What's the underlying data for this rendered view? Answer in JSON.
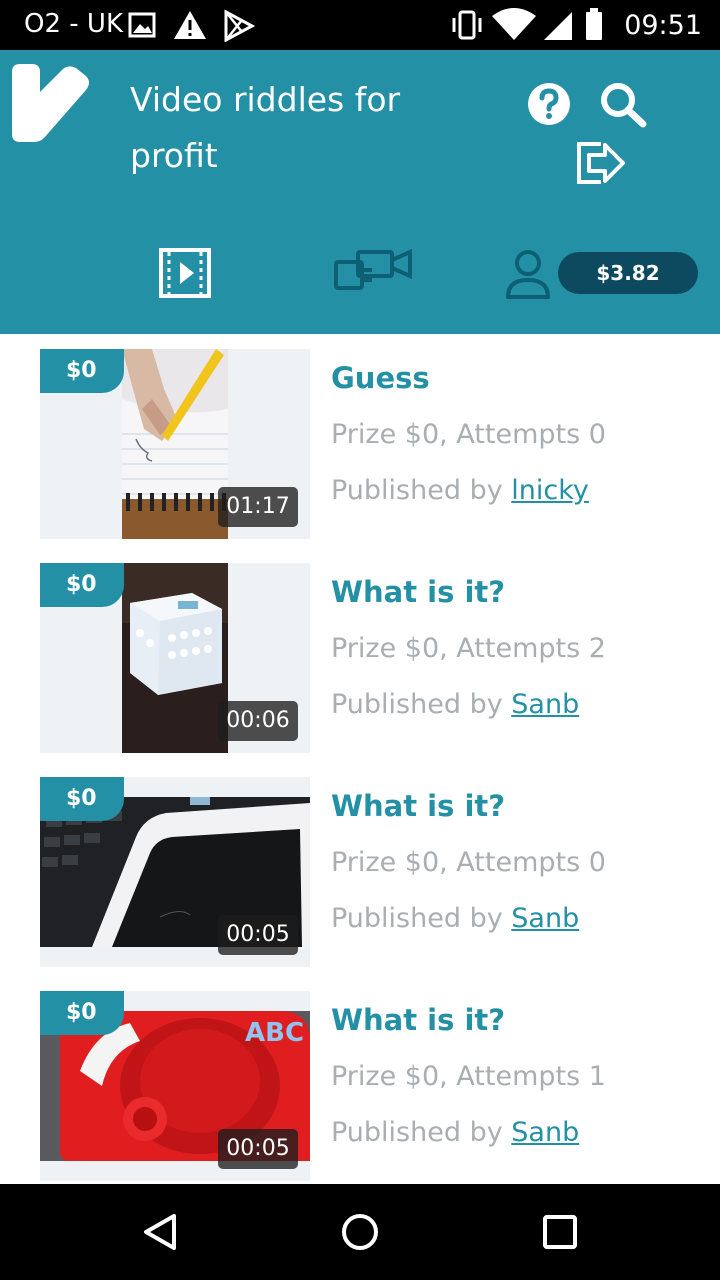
{
  "status_bar": {
    "carrier": "O2 - UK",
    "time": "09:51"
  },
  "header": {
    "title": "Video riddles for profit",
    "balance": "$3.82",
    "icons": [
      "logo-icon",
      "help-icon",
      "search-icon",
      "logout-icon",
      "videos-tab-icon",
      "video-call-tab-icon",
      "profile-tab-icon"
    ]
  },
  "colors": {
    "brand": "#2390a6",
    "balance_bg": "#0d4a60",
    "muted_text": "#a9aeb3"
  },
  "riddles": [
    {
      "prize_badge": "$0",
      "duration": "01:17",
      "title": "Guess",
      "meta": "Prize $0, Attempts 0",
      "published_prefix": "Published by ",
      "author": "lnicky"
    },
    {
      "prize_badge": "$0",
      "duration": "00:06",
      "title": "What is it?",
      "meta": "Prize $0, Attempts 2",
      "published_prefix": "Published by ",
      "author": "Sanb"
    },
    {
      "prize_badge": "$0",
      "duration": "00:05",
      "title": "What is it?",
      "meta": "Prize $0, Attempts 0",
      "published_prefix": "Published by ",
      "author": "Sanb"
    },
    {
      "prize_badge": "$0",
      "duration": "00:05",
      "title": "What is it?",
      "meta": "Prize $0, Attempts 1",
      "published_prefix": "Published by ",
      "author": "Sanb"
    }
  ],
  "nav_bar": {
    "icons": [
      "back-icon",
      "home-icon",
      "recents-icon"
    ]
  }
}
